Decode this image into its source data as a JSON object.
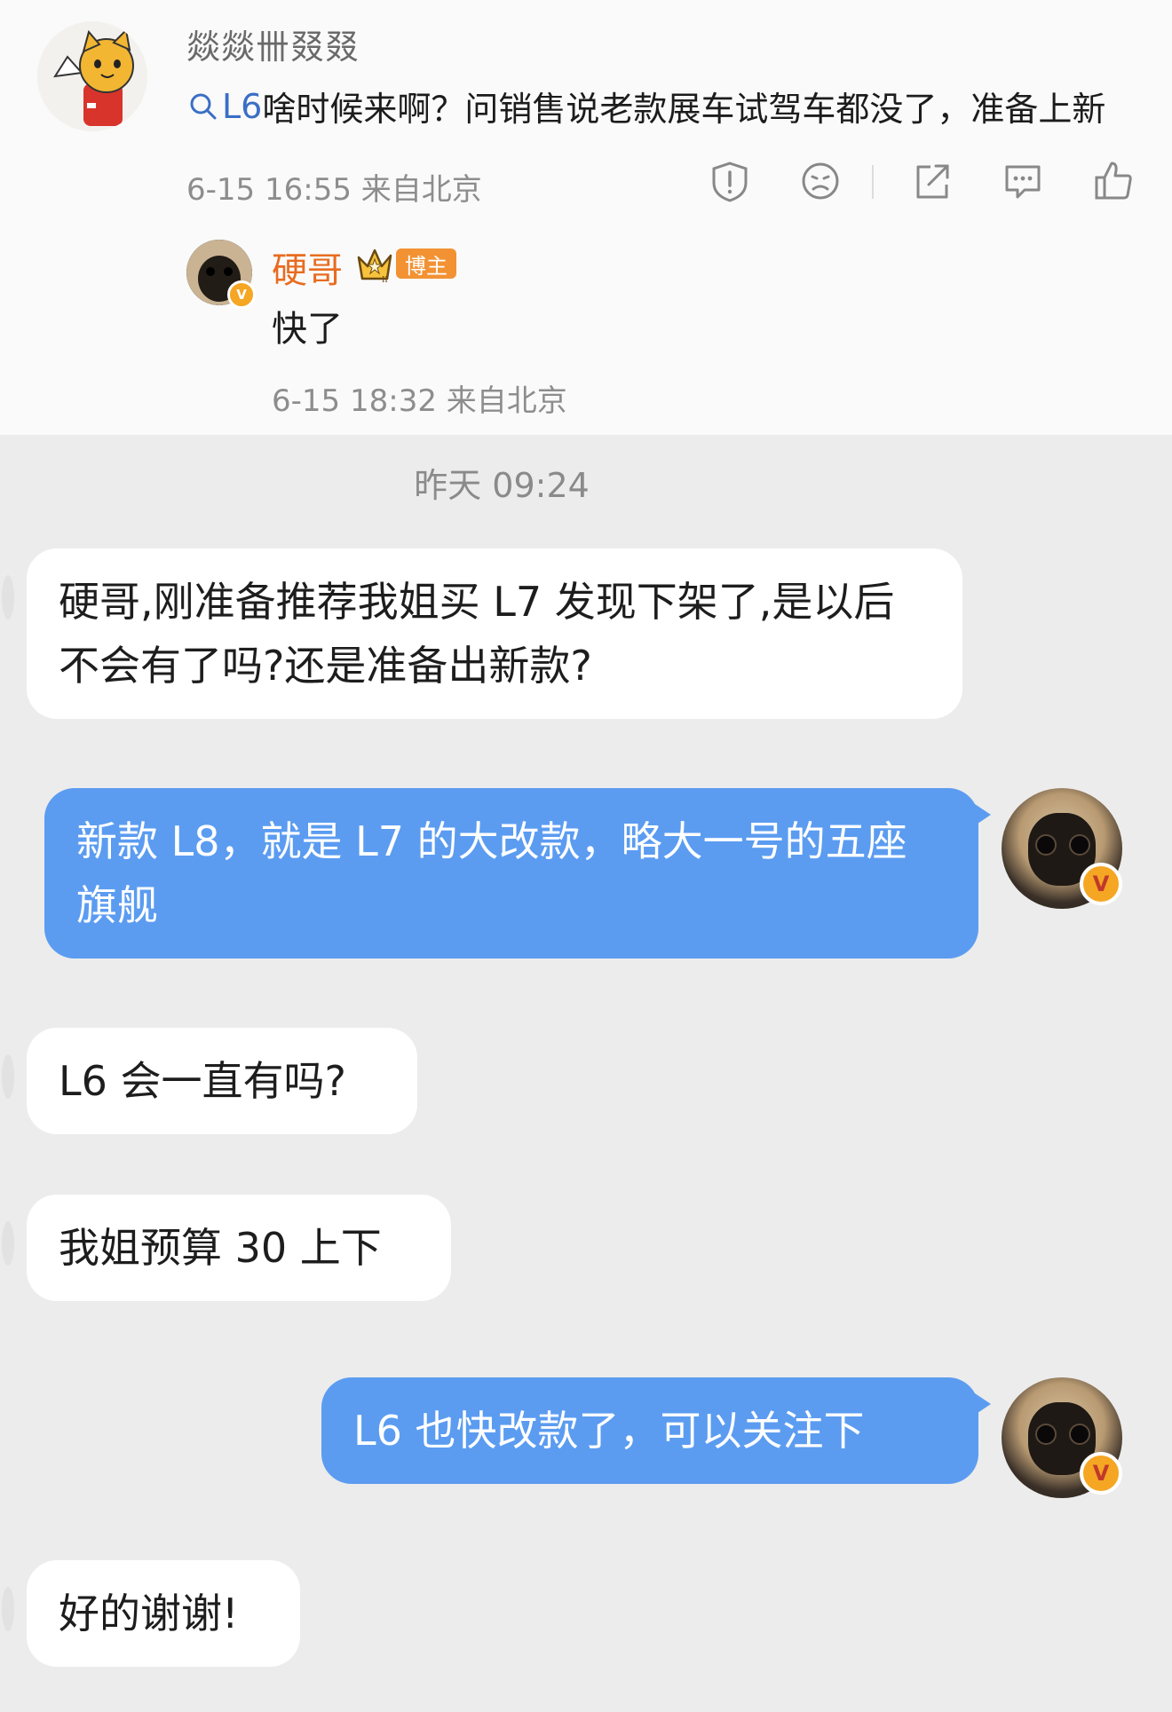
{
  "post": {
    "username": "燚燚卌叕叕",
    "topic": "L6",
    "text": "啥时候来啊？问销售说老款展车试驾车都没了，准备上新",
    "time": "6-15 16:55",
    "source": "来自北京",
    "action_icons": [
      "warning-icon",
      "dislike-icon",
      "share-icon",
      "comment-icon",
      "like-icon"
    ]
  },
  "reply": {
    "name": "硬哥",
    "badge": "博主",
    "text": "快了",
    "time": "6-15 18:32",
    "source": "来自北京"
  },
  "chat": {
    "day_stamp": "昨天 09:24",
    "messages": [
      {
        "side": "in",
        "text": "硬哥,刚准备推荐我姐买 L7 发现下架了,是以后不会有了吗?还是准备出新款?"
      },
      {
        "side": "out",
        "text": "新款 L8，就是 L7 的大改款，略大一号的五座旗舰"
      },
      {
        "side": "in",
        "text": "L6 会一直有吗?"
      },
      {
        "side": "in",
        "text": "我姐预算 30 上下"
      },
      {
        "side": "out",
        "text": "L6 也快改款了，可以关注下"
      },
      {
        "side": "in",
        "text": "好的谢谢!"
      }
    ]
  },
  "colors": {
    "accent_blue": "#5b9cf1",
    "name_orange": "#e86c1f",
    "verified_badge": "#f5a623"
  }
}
